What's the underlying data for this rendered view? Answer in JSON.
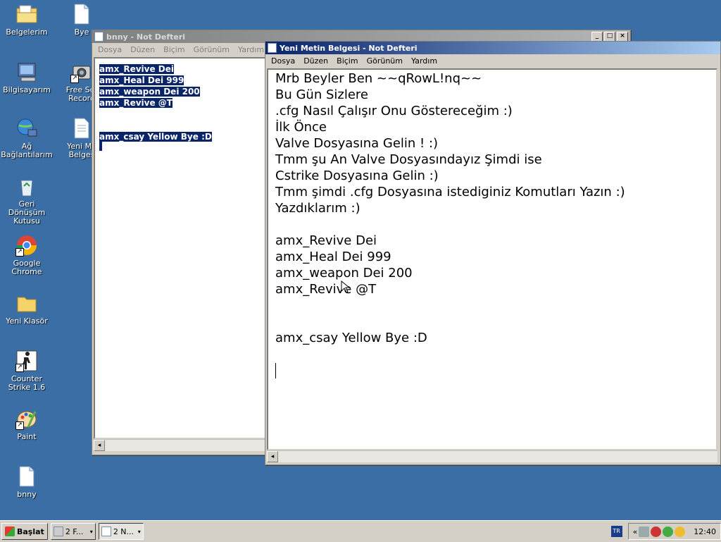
{
  "desktop": {
    "icons": [
      {
        "label": "Belgelerim",
        "icon": "my-documents-icon"
      },
      {
        "label": "Bye",
        "icon": "text-file-icon"
      },
      {
        "label": "Bilgisayarım",
        "icon": "my-computer-icon"
      },
      {
        "label": "Free Scr Record",
        "icon": "camera-icon"
      },
      {
        "label": "Ağ Bağlantılarım",
        "icon": "network-icon"
      },
      {
        "label": "Yeni Me Belges",
        "icon": "text-file-icon"
      },
      {
        "label": "Geri Dönüşüm Kutusu",
        "icon": "recycle-bin-icon"
      },
      {
        "label": "Google Chrome",
        "icon": "chrome-icon"
      },
      {
        "label": "Yeni Klasör",
        "icon": "folder-icon"
      },
      {
        "label": "Counter Strike 1.6",
        "icon": "counter-strike-icon"
      },
      {
        "label": "Paint",
        "icon": "paint-icon"
      },
      {
        "label": "bnny",
        "icon": "text-file-icon"
      }
    ]
  },
  "win_back": {
    "title": "bnny - Not Defteri",
    "menu": [
      "Dosya",
      "Düzen",
      "Biçim",
      "Görünüm",
      "Yardım"
    ],
    "lines": [
      "amx_Revive Dei",
      "amx_Heal Dei 999",
      "amx_weapon Dei 200",
      "amx_Revive @T",
      "",
      "",
      "amx_csay Yellow Bye :D"
    ]
  },
  "win_front": {
    "title": "Yeni Metin Belgesi - Not Defteri",
    "menu": [
      "Dosya",
      "Düzen",
      "Biçim",
      "Görünüm",
      "Yardım"
    ],
    "lines": [
      "Mrb Beyler Ben ~~qRowL!nq~~",
      "Bu Gün Sizlere",
      ".cfg Nasıl Çalışır Onu Göstereceğim :)",
      "İlk Önce",
      "Valve Dosyasına Gelin ! :)",
      "Tmm şu An Valve Dosyasındayız Şimdi ise",
      "Cstrike Dosyasına Gelin :)",
      "Tmm şimdi .cfg Dosyasına istediginiz Komutları Yazın :)",
      "Yazdıklarım :)",
      "",
      "amx_Revive Dei",
      "amx_Heal Dei 999",
      "amx_weapon Dei 200",
      "amx_Revive @T",
      "",
      "",
      "amx_csay Yellow Bye :D"
    ]
  },
  "taskbar": {
    "start_label": "Başlat",
    "tasks": [
      "2 F...",
      "2 N..."
    ],
    "lang": "TR",
    "clock": "12:40"
  }
}
